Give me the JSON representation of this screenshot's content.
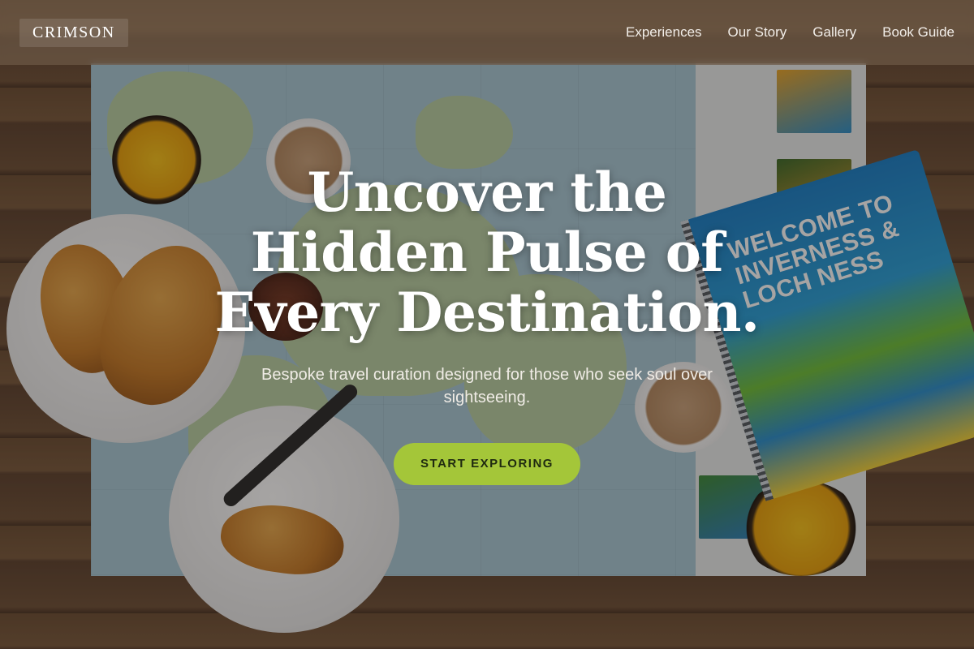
{
  "brand": {
    "name": "CRIMSON"
  },
  "nav": {
    "items": [
      {
        "label": "Experiences"
      },
      {
        "label": "Our Story"
      },
      {
        "label": "Gallery"
      },
      {
        "label": "Book Guide"
      }
    ]
  },
  "hero": {
    "title": "Uncover the Hidden Pulse of Every Destination.",
    "subtitle": "Bespoke travel curation designed for those who seek soul over sightseeing.",
    "cta_label": "START EXPLORING"
  },
  "background": {
    "guidebook_title": "WELCOME TO INVERNESS & LOCH NESS"
  },
  "colors": {
    "accent": "#a4c639",
    "text_light": "#ffffff"
  }
}
